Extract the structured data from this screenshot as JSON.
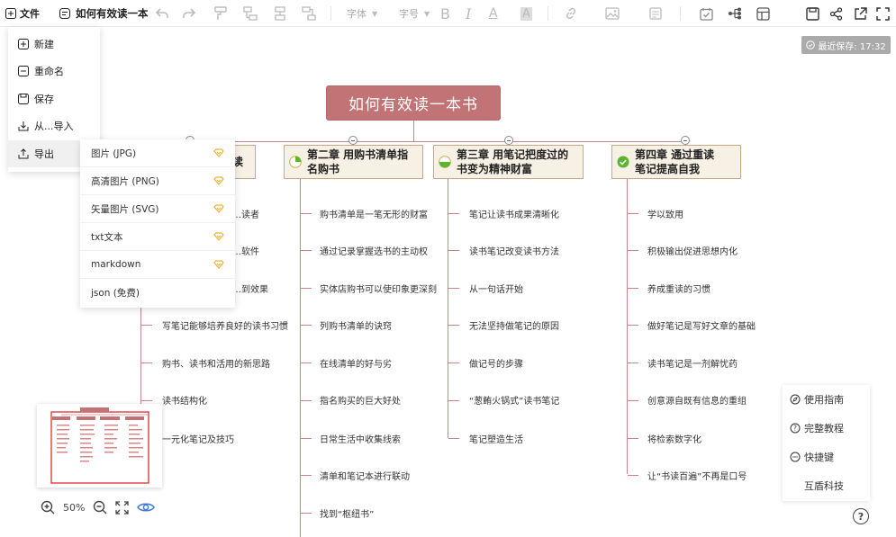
{
  "toolbar": {
    "file_label": "文件",
    "doc_title": "如何有效读一本",
    "font_label": "字体",
    "size_label": "字号",
    "bold": "B",
    "italic": "I",
    "font_color": "A",
    "highlight": "A"
  },
  "save_status": "最近保存: 17:32",
  "file_menu": [
    {
      "label": "新建",
      "icon": "plus-square-icon"
    },
    {
      "label": "重命名",
      "icon": "minus-square-icon"
    },
    {
      "label": "保存",
      "icon": "save-icon"
    },
    {
      "label": "从...导入",
      "icon": "import-icon"
    },
    {
      "label": "导出",
      "icon": "export-icon"
    }
  ],
  "export_menu": [
    {
      "label": "图片 (JPG)",
      "vip": true
    },
    {
      "label": "高清图片 (PNG)",
      "vip": true
    },
    {
      "label": "矢量图片 (SVG)",
      "vip": true
    },
    {
      "label": "txt文本",
      "vip": true
    },
    {
      "label": "markdown",
      "vip": true
    },
    {
      "label": "json (免费)",
      "vip": false
    }
  ],
  "mindmap": {
    "root": "如何有效读一本书",
    "chapters": [
      {
        "title": "第一章 … 读书",
        "visible_title_end": "读",
        "items": [
          "…读者",
          "…软件",
          "…到效果",
          "写笔记能够培养良好的读书习惯",
          "购书、读书和活用的新思路",
          "读书结构化",
          "一元化笔记及技巧"
        ]
      },
      {
        "title": "第二章  用购书清单指名购书",
        "items": [
          "购书清单是一笔无形的财富",
          "通过记录掌握选书的主动权",
          "实体店购书可以使印象更深刻",
          "列购书清单的诀窍",
          "在线清单的好与劣",
          "指名购买的巨大好处",
          "日常生活中收集线索",
          "清单和笔记本进行联动",
          "找到“枢纽书”"
        ]
      },
      {
        "title": "第三章  用笔记把度过的书变为精神财富",
        "items": [
          "笔记让读书成果清晰化",
          "读书笔记改变读书方法",
          "从一句话开始",
          "无法坚持做笔记的原因",
          "做记号的步骤",
          "“葱鲔火锅式”读书笔记",
          "笔记塑造生活"
        ]
      },
      {
        "title": "第四章  通过重读笔记提高自我",
        "items": [
          "学以致用",
          "积极输出促进思想内化",
          "养成重读的习惯",
          "做好笔记是写好文章的基础",
          "读书笔记是一剂解忧药",
          "创意源自既有信息的重组",
          "将检索数字化",
          "让“书读百遍”不再是口号"
        ]
      }
    ]
  },
  "zoom": {
    "level": "50%"
  },
  "help": [
    {
      "label": "使用指南",
      "icon": "compass-icon"
    },
    {
      "label": "完整教程",
      "icon": "question-circle-icon"
    },
    {
      "label": "快捷键",
      "icon": "keyboard-icon"
    },
    {
      "label": "互盾科技",
      "icon": ""
    }
  ],
  "help_button": "?",
  "colors": {
    "root": "#c27375",
    "chapter_bg": "#f7f0e4",
    "chapter_border": "#c9a889",
    "connector": "#c98587",
    "vip_icon": "#f0b232",
    "progress_green": "#5bb531"
  }
}
